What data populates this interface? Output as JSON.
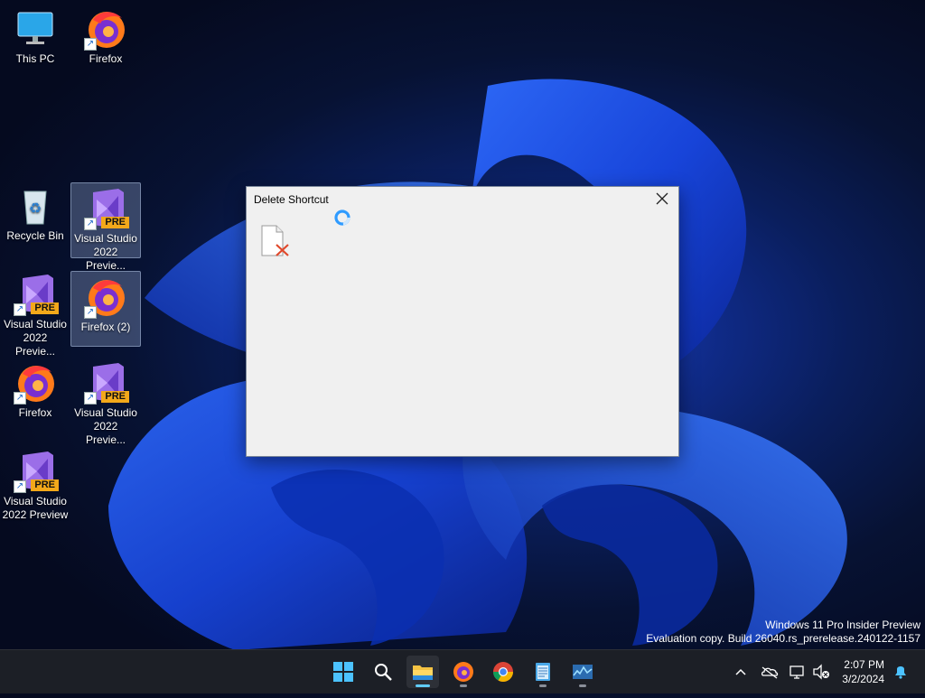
{
  "desktop": {
    "icons": [
      {
        "label": "This PC",
        "type": "computer"
      },
      {
        "label": "Firefox",
        "type": "firefox"
      },
      {
        "label": "Recycle Bin",
        "type": "recycle-bin"
      },
      {
        "label": "Visual Studio 2022 Previe...",
        "type": "visual-studio",
        "badge": "PRE"
      },
      {
        "label": "Visual Studio 2022 Previe...",
        "type": "visual-studio",
        "badge": "PRE"
      },
      {
        "label": "Firefox (2)",
        "type": "firefox"
      },
      {
        "label": "Firefox",
        "type": "firefox"
      },
      {
        "label": "Visual Studio 2022 Previe...",
        "type": "visual-studio",
        "badge": "PRE"
      },
      {
        "label": "Visual Studio 2022 Preview",
        "type": "visual-studio",
        "badge": "PRE"
      }
    ]
  },
  "dialog": {
    "title": "Delete Shortcut",
    "close_icon": "close-icon",
    "file_icon": "file-delete-icon"
  },
  "watermark": {
    "line1": "Windows 11 Pro Insider Preview",
    "line2": "Evaluation copy. Build 26040.rs_prerelease.240122-1157"
  },
  "taskbar": {
    "apps": [
      "start-icon",
      "search-icon",
      "file-explorer-icon",
      "firefox-icon",
      "chrome-icon",
      "notepad-icon",
      "task-manager-icon"
    ],
    "tray_icons": [
      "chevron-up-icon",
      "onedrive-offline-icon",
      "network-icon",
      "volume-muted-icon",
      "notification-bell-icon"
    ],
    "clock": {
      "time": "2:07 PM",
      "date": "3/2/2024"
    }
  },
  "colors": {
    "accent": "#60cdff",
    "pre_badge": "#f3a81a",
    "dialog_bg": "#f0f0f0"
  }
}
